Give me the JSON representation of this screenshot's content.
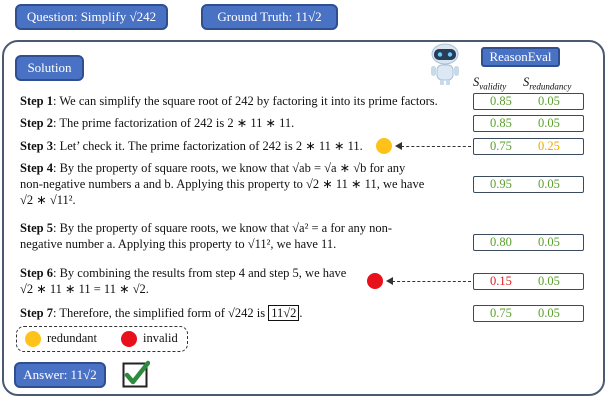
{
  "question_label": "Question: Simplify √242",
  "ground_truth_label": "Ground Truth: 11√2",
  "solution_label": "Solution",
  "reasoneval_label": "ReasonEval",
  "columns": {
    "validity": "S",
    "validity_sub": "validity",
    "redundancy": "S",
    "redundancy_sub": "redundancy"
  },
  "steps": [
    {
      "label": "Step 1",
      "text": ": We can simplify the square root of 242 by factoring it into its prime factors."
    },
    {
      "label": "Step 2",
      "text": ": The prime factorization of 242 is 2 ∗ 11 ∗ 11."
    },
    {
      "label": "Step 3",
      "text": ": Let’ check it. The prime factorization of 242 is 2 ∗ 11 ∗ 11."
    },
    {
      "label": "Step 4",
      "line1": ": By the property of square roots, we know that √ab = √a ∗ √b for any",
      "line2": "non-negative numbers a and b. Applying this property to √2 ∗ 11 ∗ 11, we have",
      "line3": "√2 ∗ √11²."
    },
    {
      "label": "Step 5",
      "line1": ": By the property of square roots, we know that √a² = a for any non-",
      "line2": "negative number a. Applying this property to √11², we have 11."
    },
    {
      "label": "Step 6",
      "line1": ": By combining the results from step 4 and step 5, we have",
      "line2": "√2 ∗ 11 ∗ 11 = 11 ∗ √2."
    },
    {
      "label": "Step 7",
      "text": ": Therefore, the simplified form of √242 is ",
      "answer_box": "11√2",
      "end": "."
    }
  ],
  "scores": [
    {
      "validity": "0.85",
      "redundancy": "0.05"
    },
    {
      "validity": "0.85",
      "redundancy": "0.05"
    },
    {
      "validity": "0.75",
      "redundancy": "0.25"
    },
    {
      "validity": "0.95",
      "redundancy": "0.05"
    },
    {
      "validity": "0.80",
      "redundancy": "0.05"
    },
    {
      "validity": "0.15",
      "redundancy": "0.05"
    },
    {
      "validity": "0.75",
      "redundancy": "0.05"
    }
  ],
  "legend": {
    "redundant": "redundant",
    "invalid": "invalid"
  },
  "answer_label": "Answer: 11√2",
  "colors": {
    "button_blue": "#4a72c4",
    "green": "#5aa02c",
    "orange": "#f0a800",
    "red": "#e02020",
    "redundant_dot": "#ffc21a",
    "invalid_dot": "#e8101a"
  },
  "icons": [
    "robot-icon",
    "checkmark-icon"
  ]
}
